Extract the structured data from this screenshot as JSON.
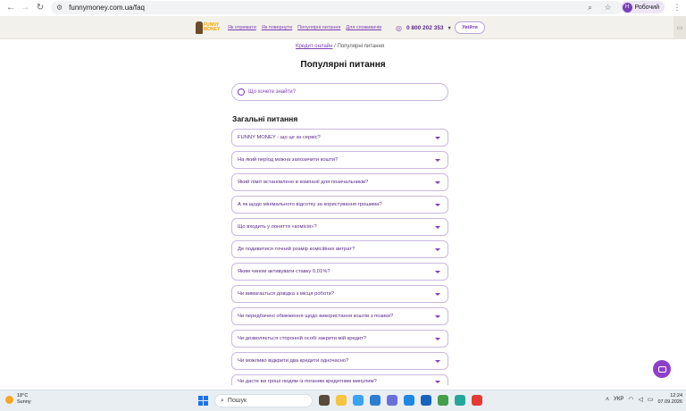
{
  "browser": {
    "url": "funnymoney.com.ua/faq",
    "profile_initial": "Н",
    "profile_name": "Робочий"
  },
  "site": {
    "logo_line1": "FUNNY",
    "logo_line2": "MONEY",
    "nav": [
      "Як отримати",
      "Як повернути",
      "Популярні питання",
      "Для споживачів"
    ],
    "phone": "0 800 202 353",
    "login_label": "Увійти"
  },
  "breadcrumb": {
    "link": "Кредит онлайн",
    "separator": "/",
    "current": "Популярні питання"
  },
  "page_title": "Популярні питання",
  "search": {
    "placeholder": "Що хочете знайти?"
  },
  "section_title": "Загальні питання",
  "faq": [
    "FUNNY MONEY - що це за сервіс?",
    "На який період можна запозичити кошти?",
    "Який ліміт встановлено в компанії для позичальників?",
    "А як щодо мінімального відсотку за користування грошима?",
    "Що входить у поняття «комісія»?",
    "Де подивитися точний розмір комісійних витрат?",
    "Яким чином активувати ставку 0,01%?",
    "Чи вимагається довідка з місця роботи?",
    "Чи передбачені обмеження щодо використання коштів з позики?",
    "Чи дозволяється сторонній особі закрити мій кредит?",
    "Чи можливо відкрити два кредити одночасно?",
    "Чи дасте ви гроші людям із поганим кредитним минулим?"
  ],
  "taskbar": {
    "temperature": "18°C",
    "weather": "Sunny",
    "search_placeholder": "Пошук",
    "lang": "УКР",
    "time": "12:24",
    "date": "07.09.2026"
  },
  "colors": {
    "accent": "#7b3fb8",
    "header_bg": "#f3f1ec",
    "fab": "#8e3fc8"
  }
}
